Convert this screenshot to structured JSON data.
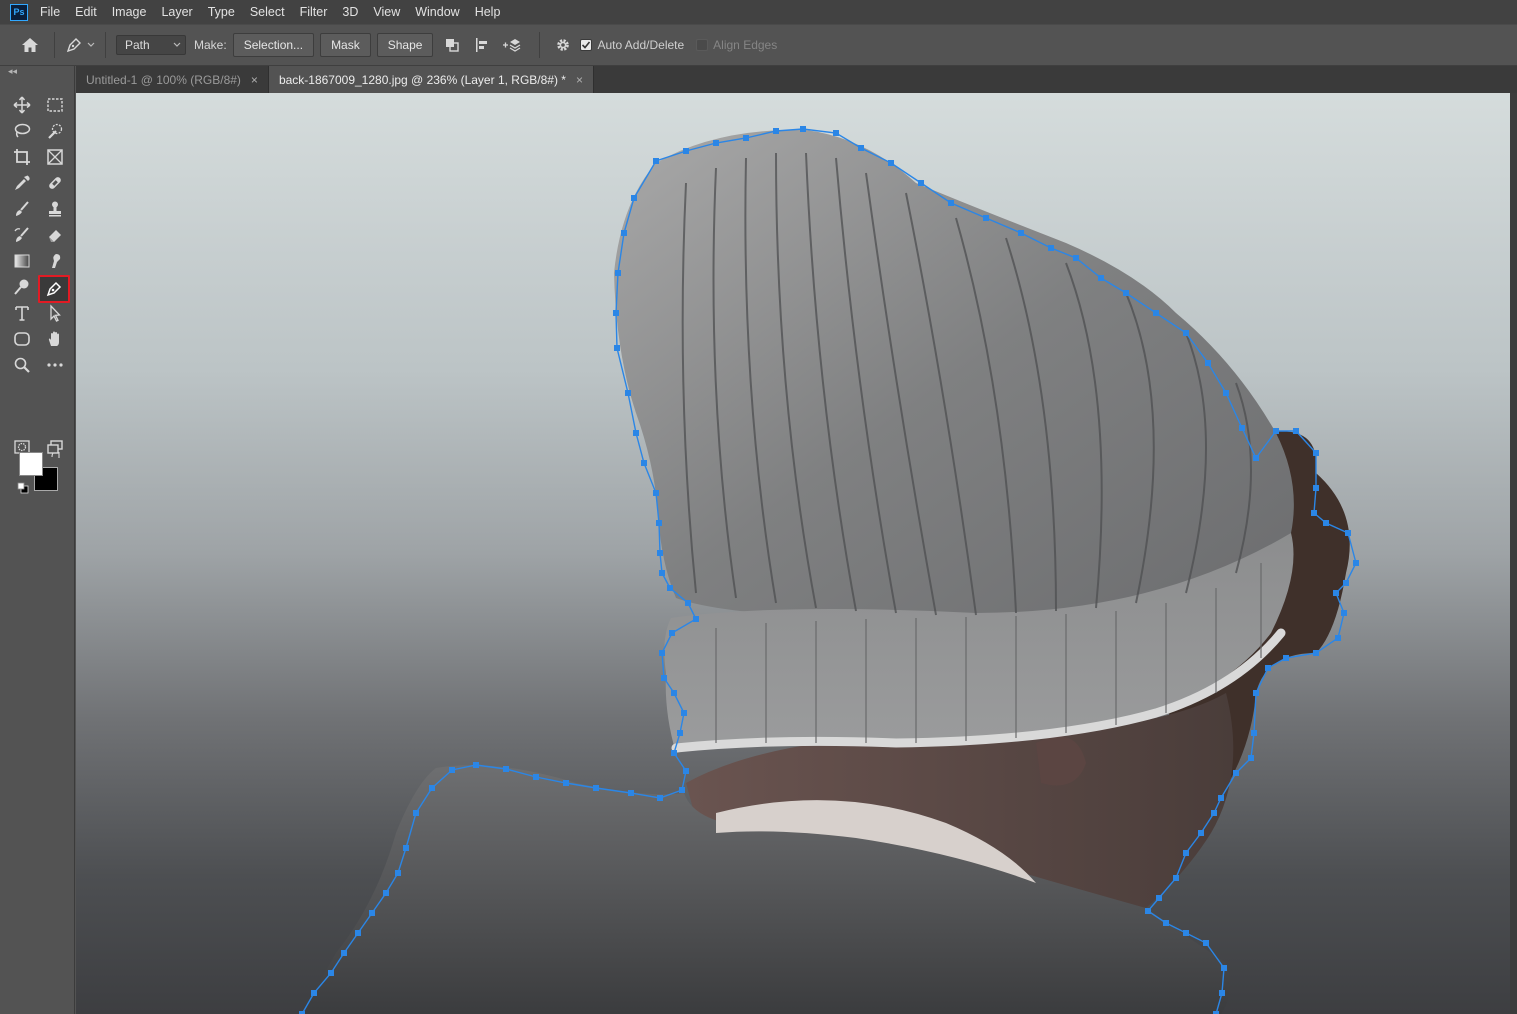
{
  "app": {
    "logo_text": "Ps"
  },
  "menu": [
    "File",
    "Edit",
    "Image",
    "Layer",
    "Type",
    "Select",
    "Filter",
    "3D",
    "View",
    "Window",
    "Help"
  ],
  "options": {
    "mode_value": "Path",
    "make_label": "Make:",
    "selection_button": "Selection...",
    "mask_button": "Mask",
    "shape_button": "Shape",
    "auto_add_delete_label": "Auto Add/Delete",
    "auto_add_delete_checked": true,
    "align_edges_label": "Align Edges",
    "align_edges_checked": false
  },
  "toolbar": {
    "active_tool": "pen-tool",
    "foreground_color": "#ffffff",
    "background_color": "#000000",
    "highlight_color": "#e21b24"
  },
  "tabs": [
    {
      "label": "Untitled-1 @ 100% (RGB/8#)",
      "active": false
    },
    {
      "label": "back-1867009_1280.jpg @ 236% (Layer 1, RGB/8#) *",
      "active": true
    }
  ],
  "tab_close_glyph": "×",
  "canvas": {
    "path_color": "#2b86e6",
    "photo_subject": "back of person wearing grey knit beanie and grey hooded coat"
  }
}
